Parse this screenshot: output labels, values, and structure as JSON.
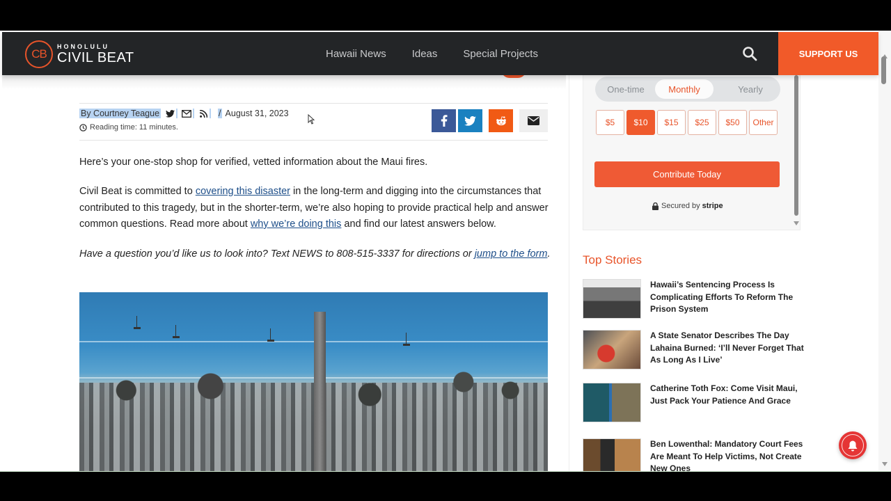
{
  "header": {
    "logo_mark": "CB",
    "logo_small": "HONOLULU",
    "logo_big": "CIVIL BEAT",
    "nav": [
      "Hawaii News",
      "Ideas",
      "Special Projects"
    ],
    "search_icon": "search-icon",
    "support_label": "SUPPORT US"
  },
  "colors": {
    "brand_orange": "#f15a29",
    "header_bg": "#232527",
    "link": "#1d4e89"
  },
  "article": {
    "byline": "By Courtney Teague",
    "byline_icons": [
      "twitter-icon",
      "mail-icon",
      "rss-icon"
    ],
    "slash": "/",
    "date": "August 31, 2023",
    "reading_time": "Reading time: 11 minutes.",
    "share_buttons": [
      "facebook-icon",
      "twitter-icon",
      "reddit-icon",
      "email-icon"
    ],
    "p1": "Here’s your one-stop shop for verified, vetted information about the Maui fires.",
    "p2": {
      "before": "Civil Beat is committed to ",
      "link1": "covering this disaster",
      "middle": " in the long-term and digging into the circumstances that contributed to this tragedy, but in the shorter-term, we’re also hoping to provide practical help and answer common questions. Read more about ",
      "link2": "why we’re doing this",
      "after": " and find our latest answers below."
    },
    "p3": {
      "before": "Have a question you’d like us to look into? Text NEWS to 808-515-3337 for directions or ",
      "link": "jump to the form",
      "after": "."
    },
    "hero_alt": "Aerial view of burned Lahaina with smokestack and ocean"
  },
  "donate": {
    "frequencies": [
      "One-time",
      "Monthly",
      "Yearly"
    ],
    "selected_frequency": "Monthly",
    "amounts": [
      "$5",
      "$10",
      "$15",
      "$25",
      "$50",
      "Other"
    ],
    "selected_amount": "$10",
    "cta": "Contribute Today",
    "secured_prefix": "Secured by",
    "secured_brand": "stripe"
  },
  "top_stories": {
    "title": "Top Stories",
    "items": [
      {
        "title": "Hawaii’s Sentencing Process Is Complicating Efforts To Reform The Prison System"
      },
      {
        "title": "A State Senator Describes The Day Lahaina Burned: ‘I’ll Never Forget That As Long As I Live’"
      },
      {
        "title": "Catherine Toth Fox: Come Visit Maui, Just Pack Your Patience And Grace"
      },
      {
        "title": "Ben Lowenthal: Mandatory Court Fees Are Meant To Help Victims, Not Create New Ones"
      }
    ]
  },
  "notification_bell": "bell-icon"
}
